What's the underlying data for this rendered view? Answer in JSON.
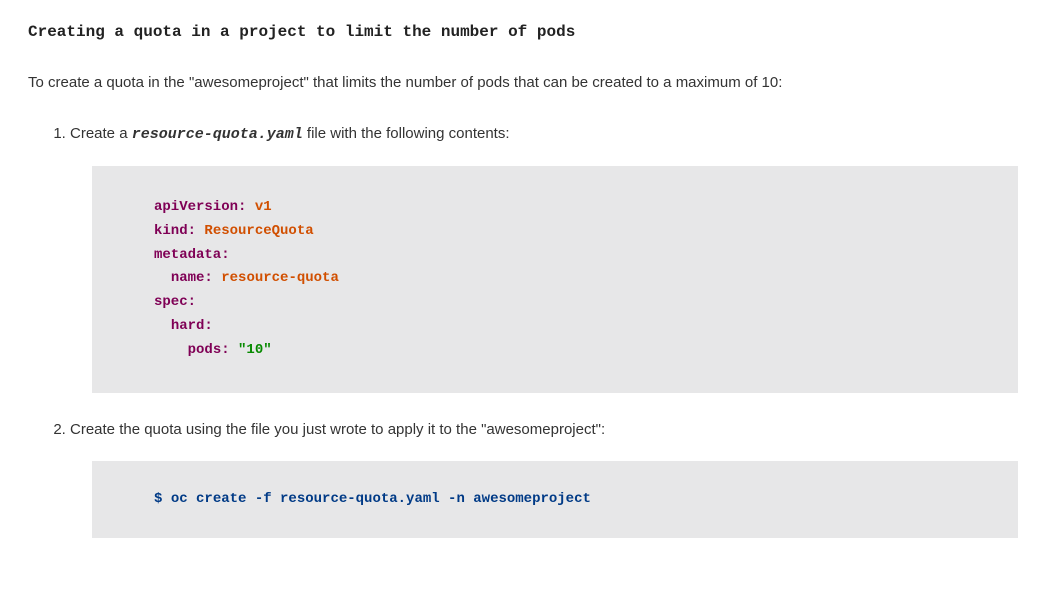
{
  "heading": "Creating a quota in a project to limit the number of pods",
  "intro": "To create a quota in the \"awesomeproject\" that limits the number of pods that can be created to a maximum of 10:",
  "steps": {
    "s1": {
      "prefix": "Create a ",
      "code": "resource-quota.yaml",
      "suffix": " file with the following contents:"
    },
    "s2": {
      "text": "Create the quota using the file you just wrote to apply it to the \"awesomeproject\":"
    }
  },
  "yaml": {
    "apiVersionKey": "apiVersion:",
    "apiVersionVal": "v1",
    "kindKey": "kind:",
    "kindVal": "ResourceQuota",
    "metadataKey": "metadata:",
    "nameKey": "name:",
    "nameVal": "resource-quota",
    "specKey": "spec:",
    "hardKey": "hard:",
    "podsKey": "pods:",
    "podsVal": "\"10\""
  },
  "cmd": {
    "prompt": "$",
    "line": "oc create -f resource-quota.yaml -n awesomeproject"
  }
}
